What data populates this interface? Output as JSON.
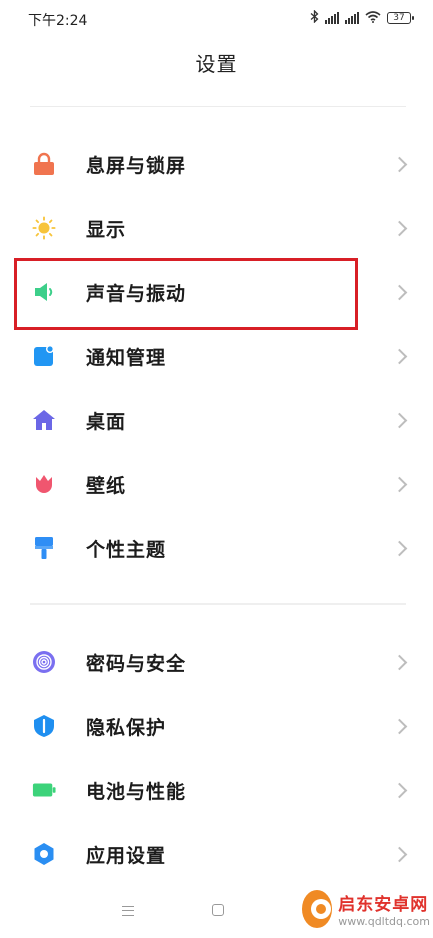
{
  "status_bar": {
    "time": "下午2:24",
    "battery": "37"
  },
  "header": {
    "title": "设置"
  },
  "items": [
    {
      "label": "息屏与锁屏",
      "icon": "lock-icon",
      "color": "#f0744f"
    },
    {
      "label": "显示",
      "icon": "sun-icon",
      "color": "#f7c43a"
    },
    {
      "label": "声音与振动",
      "icon": "speaker-icon",
      "color": "#3dcf8a"
    },
    {
      "label": "通知管理",
      "icon": "notification-icon",
      "color": "#2196f3"
    },
    {
      "label": "桌面",
      "icon": "home-icon",
      "color": "#6b67e6"
    },
    {
      "label": "壁纸",
      "icon": "tulip-icon",
      "color": "#f0566f"
    },
    {
      "label": "个性主题",
      "icon": "brush-icon",
      "color": "#2f8ef5"
    },
    {
      "label": "密码与安全",
      "icon": "fingerprint-icon",
      "color": "#7a6ff0"
    },
    {
      "label": "隐私保护",
      "icon": "shield-icon",
      "color": "#1f8ff0"
    },
    {
      "label": "电池与性能",
      "icon": "battery-icon",
      "color": "#3cd37a"
    },
    {
      "label": "应用设置",
      "icon": "gear-icon",
      "color": "#2a8ef2"
    }
  ],
  "highlight_color": "#d81f26",
  "watermark": {
    "title": "启东安卓网",
    "url": "www.qdltdq.com"
  }
}
